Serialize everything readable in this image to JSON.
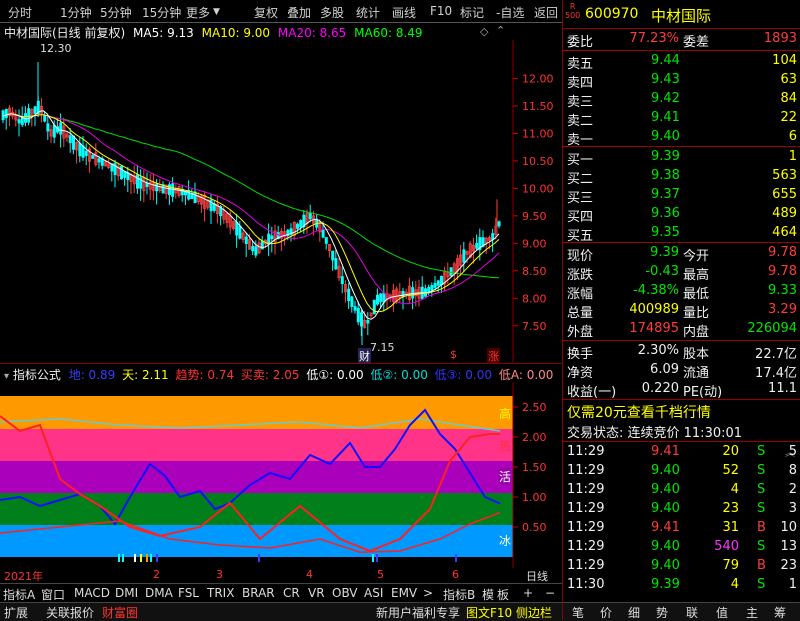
{
  "toolbar": {
    "left": [
      "分时",
      "1分钟",
      "5分钟",
      "15分钟",
      "更多"
    ],
    "right": [
      "复权",
      "叠加",
      "多股",
      "统计",
      "画线",
      "F10",
      "标记",
      "-自选",
      "返回"
    ]
  },
  "chart": {
    "name": "中材国际(日线 前复权)",
    "ma": [
      {
        "label": "MA5: 9.13",
        "color": "#ffffff"
      },
      {
        "label": "MA10: 9.00",
        "color": "#ffff00"
      },
      {
        "label": "MA20: 8.65",
        "color": "#ff00ff"
      },
      {
        "label": "MA60: 8.49",
        "color": "#00ff00"
      }
    ],
    "high_mark": "12.30",
    "low_mark": "7.15",
    "y_ticks": [
      "12.00",
      "11.50",
      "11.00",
      "10.50",
      "10.00",
      "9.50",
      "9.00",
      "8.50",
      "8.00",
      "7.50"
    ],
    "markers": [
      "财",
      "$",
      "涨"
    ]
  },
  "indicator": {
    "name": "指标公式",
    "values": [
      {
        "label": "地: 0.89",
        "color": "#3c3cff"
      },
      {
        "label": "天: 2.11",
        "color": "#ffff00"
      },
      {
        "label": "趋势: 0.74",
        "color": "#ff3030"
      },
      {
        "label": "买卖: 2.05",
        "color": "#ff3030"
      },
      {
        "label": "低①: 0.00",
        "color": "#ffffff"
      },
      {
        "label": "低②: 0.00",
        "color": "#00e0e0"
      },
      {
        "label": "低③: 0.00",
        "color": "#3c3cff"
      },
      {
        "label": "低A: 0.00",
        "color": "#ff8080"
      }
    ],
    "y_ticks": [
      "2.50",
      "2.00",
      "1.50",
      "1.00",
      "0.50"
    ],
    "zones": [
      "高",
      "热",
      "活",
      "冰"
    ],
    "timeline": {
      "year": "2021年",
      "months": [
        "2",
        "3",
        "4",
        "5",
        "6"
      ],
      "period": "日线"
    }
  },
  "tabs": [
    "指标A",
    "窗口",
    "MACD",
    "DMI",
    "DMA",
    "FSL",
    "TRIX",
    "BRAR",
    "CR",
    "VR",
    "OBV",
    "ASI",
    "EMV",
    ">",
    "指标B",
    "模",
    "板",
    "+",
    "−"
  ],
  "status": {
    "items": [
      "扩展",
      "关联报价",
      "财富圈"
    ],
    "promo": "新用户福利专享",
    "sidebar": [
      "图文F10",
      "侧边栏"
    ],
    "right_tabs": [
      "笔",
      "价",
      "细",
      "势",
      "联",
      "值",
      "主",
      "筹"
    ]
  },
  "quote": {
    "code": "600970",
    "name": "中材国际",
    "badge_top": "R",
    "badge_bottom": "500",
    "weibi_label": "委比",
    "weibi": "77.23%",
    "weicha_label": "委差",
    "weicha": "1893",
    "asks": [
      {
        "label": "卖五",
        "price": "9.44",
        "vol": "104"
      },
      {
        "label": "卖四",
        "price": "9.43",
        "vol": "63"
      },
      {
        "label": "卖三",
        "price": "9.42",
        "vol": "84"
      },
      {
        "label": "卖二",
        "price": "9.41",
        "vol": "22"
      },
      {
        "label": "卖一",
        "price": "9.40",
        "vol": "6"
      }
    ],
    "bids": [
      {
        "label": "买一",
        "price": "9.39",
        "vol": "1"
      },
      {
        "label": "买二",
        "price": "9.38",
        "vol": "563"
      },
      {
        "label": "买三",
        "price": "9.37",
        "vol": "655"
      },
      {
        "label": "买四",
        "price": "9.36",
        "vol": "489"
      },
      {
        "label": "买五",
        "price": "9.35",
        "vol": "464"
      }
    ],
    "stats": [
      {
        "l1": "现价",
        "v1": "9.39",
        "c1": "green",
        "l2": "今开",
        "v2": "9.78",
        "c2": "red"
      },
      {
        "l1": "涨跌",
        "v1": "-0.43",
        "c1": "green",
        "l2": "最高",
        "v2": "9.78",
        "c2": "red"
      },
      {
        "l1": "涨幅",
        "v1": "-4.38%",
        "c1": "green",
        "l2": "最低",
        "v2": "9.33",
        "c2": "green"
      },
      {
        "l1": "总量",
        "v1": "400989",
        "c1": "yellow",
        "l2": "量比",
        "v2": "3.29",
        "c2": "red"
      },
      {
        "l1": "外盘",
        "v1": "174895",
        "c1": "red",
        "l2": "内盘",
        "v2": "226094",
        "c2": "green"
      }
    ],
    "fund": [
      {
        "l1": "换手",
        "v1": "2.30%",
        "l2": "股本",
        "v2": "22.7亿"
      },
      {
        "l1": "净资",
        "v1": "6.09",
        "l2": "流通",
        "v2": "17.4亿"
      },
      {
        "l1": "收益(一)",
        "v1": "0.220",
        "l2": "PE(动)",
        "v2": "11.1"
      }
    ],
    "promo": "仅需20元查看千档行情",
    "trade_status": "交易状态: 连续竞价 11:30:01",
    "ticks": [
      {
        "t": "11:29",
        "p": "9.41",
        "v": "20",
        "s": "S",
        "n": "5",
        "pc": "red",
        "vc": "yellow",
        "sc": "green"
      },
      {
        "t": "11:29",
        "p": "9.40",
        "v": "52",
        "s": "S",
        "n": "8",
        "pc": "green",
        "vc": "yellow",
        "sc": "green"
      },
      {
        "t": "11:29",
        "p": "9.40",
        "v": "4",
        "s": "S",
        "n": "2",
        "pc": "green",
        "vc": "yellow",
        "sc": "green"
      },
      {
        "t": "11:29",
        "p": "9.40",
        "v": "23",
        "s": "S",
        "n": "3",
        "pc": "green",
        "vc": "yellow",
        "sc": "green"
      },
      {
        "t": "11:29",
        "p": "9.41",
        "v": "31",
        "s": "B",
        "n": "10",
        "pc": "red",
        "vc": "yellow",
        "sc": "red"
      },
      {
        "t": "11:29",
        "p": "9.40",
        "v": "540",
        "s": "S",
        "n": "13",
        "pc": "green",
        "vc": "magenta",
        "sc": "green"
      },
      {
        "t": "11:29",
        "p": "9.40",
        "v": "79",
        "s": "B",
        "n": "23",
        "pc": "green",
        "vc": "yellow",
        "sc": "red"
      },
      {
        "t": "11:30",
        "p": "9.39",
        "v": "4",
        "s": "S",
        "n": "1",
        "pc": "green",
        "vc": "yellow",
        "sc": "green"
      }
    ]
  }
}
